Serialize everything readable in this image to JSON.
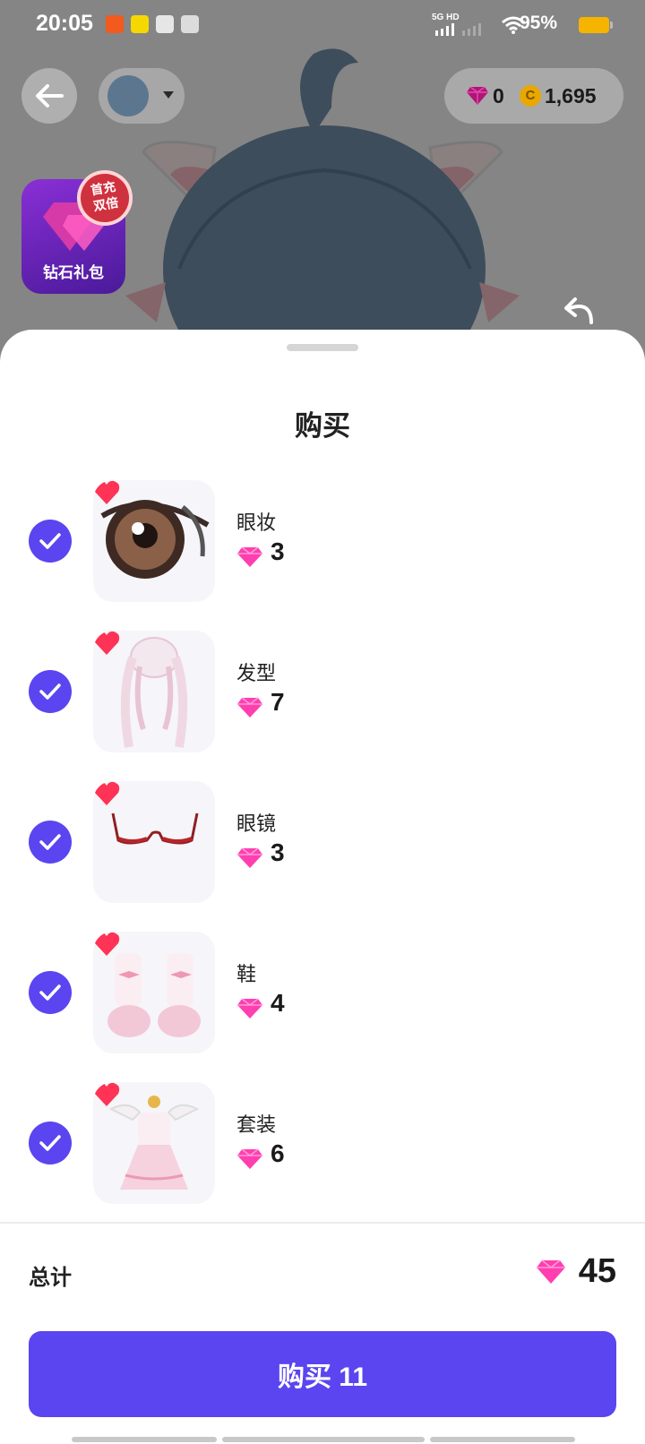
{
  "status_bar": {
    "time": "20:05",
    "network": "5G HD",
    "battery": "95%"
  },
  "top_bar": {
    "diamonds": "0",
    "coins": "1,695"
  },
  "promo": {
    "label": "钻石礼包",
    "badge": "首充\n双倍"
  },
  "sheet": {
    "title": "购买",
    "items": [
      {
        "name": "眼妆",
        "price": "3",
        "checked": true,
        "favorited": true
      },
      {
        "name": "发型",
        "price": "7",
        "checked": true,
        "favorited": true
      },
      {
        "name": "眼镜",
        "price": "3",
        "checked": true,
        "favorited": true
      },
      {
        "name": "鞋",
        "price": "4",
        "checked": true,
        "favorited": true
      },
      {
        "name": "套装",
        "price": "6",
        "checked": true,
        "favorited": true
      }
    ],
    "total_label": "总计",
    "total_value": "45",
    "buy_button": "购买 11"
  },
  "colors": {
    "accent": "#5a45f0",
    "diamond": "#ff3fb0",
    "heart": "#ff3355"
  }
}
